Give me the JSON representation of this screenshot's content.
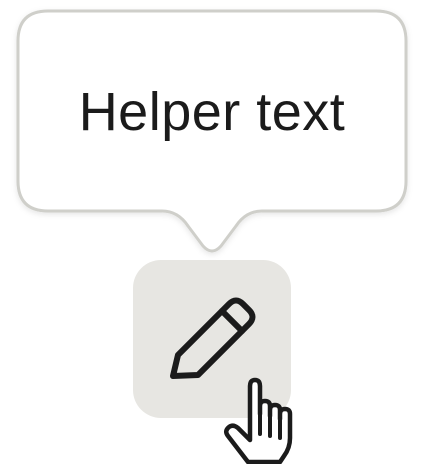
{
  "tooltip": {
    "text": "Helper text"
  },
  "icon_button": {
    "icon": "pencil-icon",
    "background": "#e7e6e2"
  },
  "cursor": {
    "icon": "hand-pointer-icon"
  },
  "colors": {
    "tooltip_border": "#cfcfca",
    "text": "#1b1b1b",
    "icon_stroke": "#1b1b1b"
  }
}
